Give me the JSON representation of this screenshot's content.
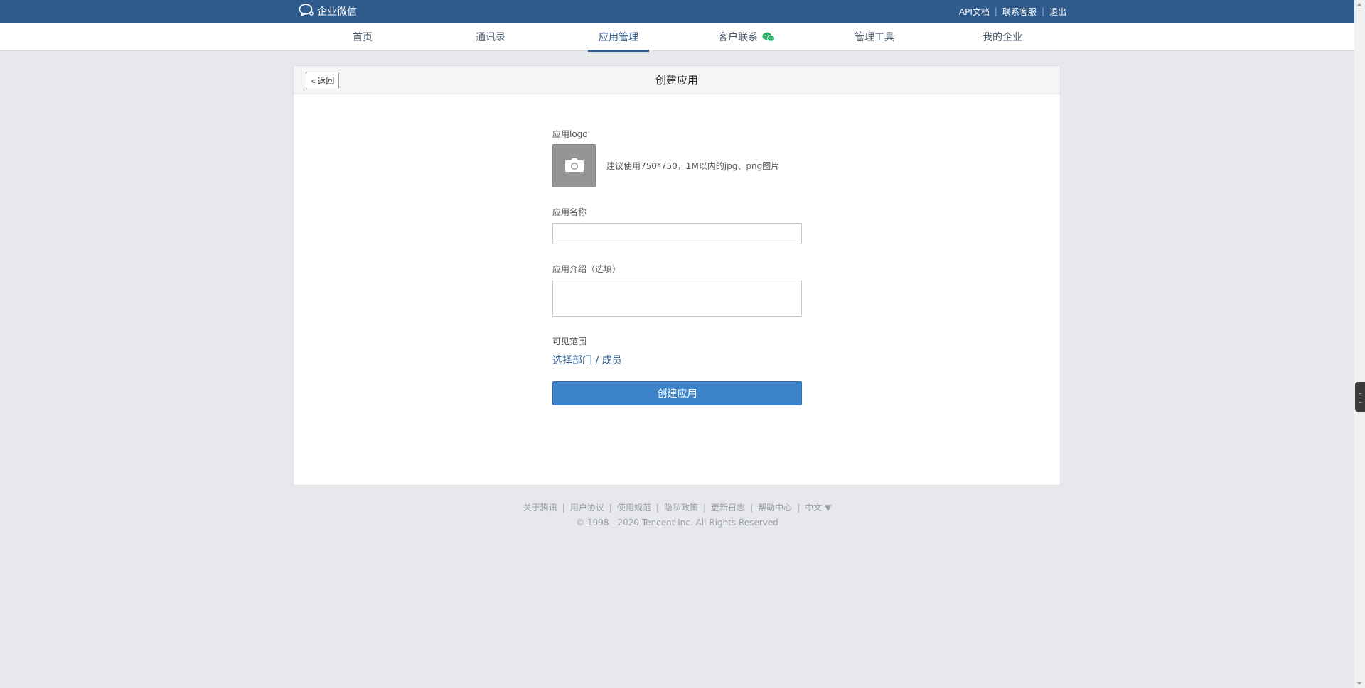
{
  "topbar": {
    "brand": "企业微信",
    "links": [
      "API文档",
      "联系客服",
      "退出"
    ]
  },
  "nav": {
    "items": [
      "首页",
      "通讯录",
      "应用管理",
      "客户联系",
      "管理工具",
      "我的企业"
    ],
    "active": "应用管理"
  },
  "panel": {
    "back_label": "返回",
    "title": "创建应用"
  },
  "form": {
    "logo_label": "应用logo",
    "logo_hint": "建议使用750*750，1M以内的jpg、png图片",
    "name_label": "应用名称",
    "name_value": "",
    "intro_label": "应用介绍（选填）",
    "intro_value": "",
    "scope_label": "可见范围",
    "scope_link": "选择部门 / 成员",
    "submit_label": "创建应用"
  },
  "footer": {
    "links": [
      "关于腾讯",
      "用户协议",
      "使用规范",
      "隐私政策",
      "更新日志",
      "帮助中心",
      "中文 ▼"
    ],
    "copyright": "© 1998 - 2020 Tencent Inc. All Rights Reserved"
  },
  "colors": {
    "topbar": "#2e5a8c",
    "primary_button": "#3b82c9",
    "link": "#2e5a8c",
    "wechat_green": "#2aae67"
  }
}
